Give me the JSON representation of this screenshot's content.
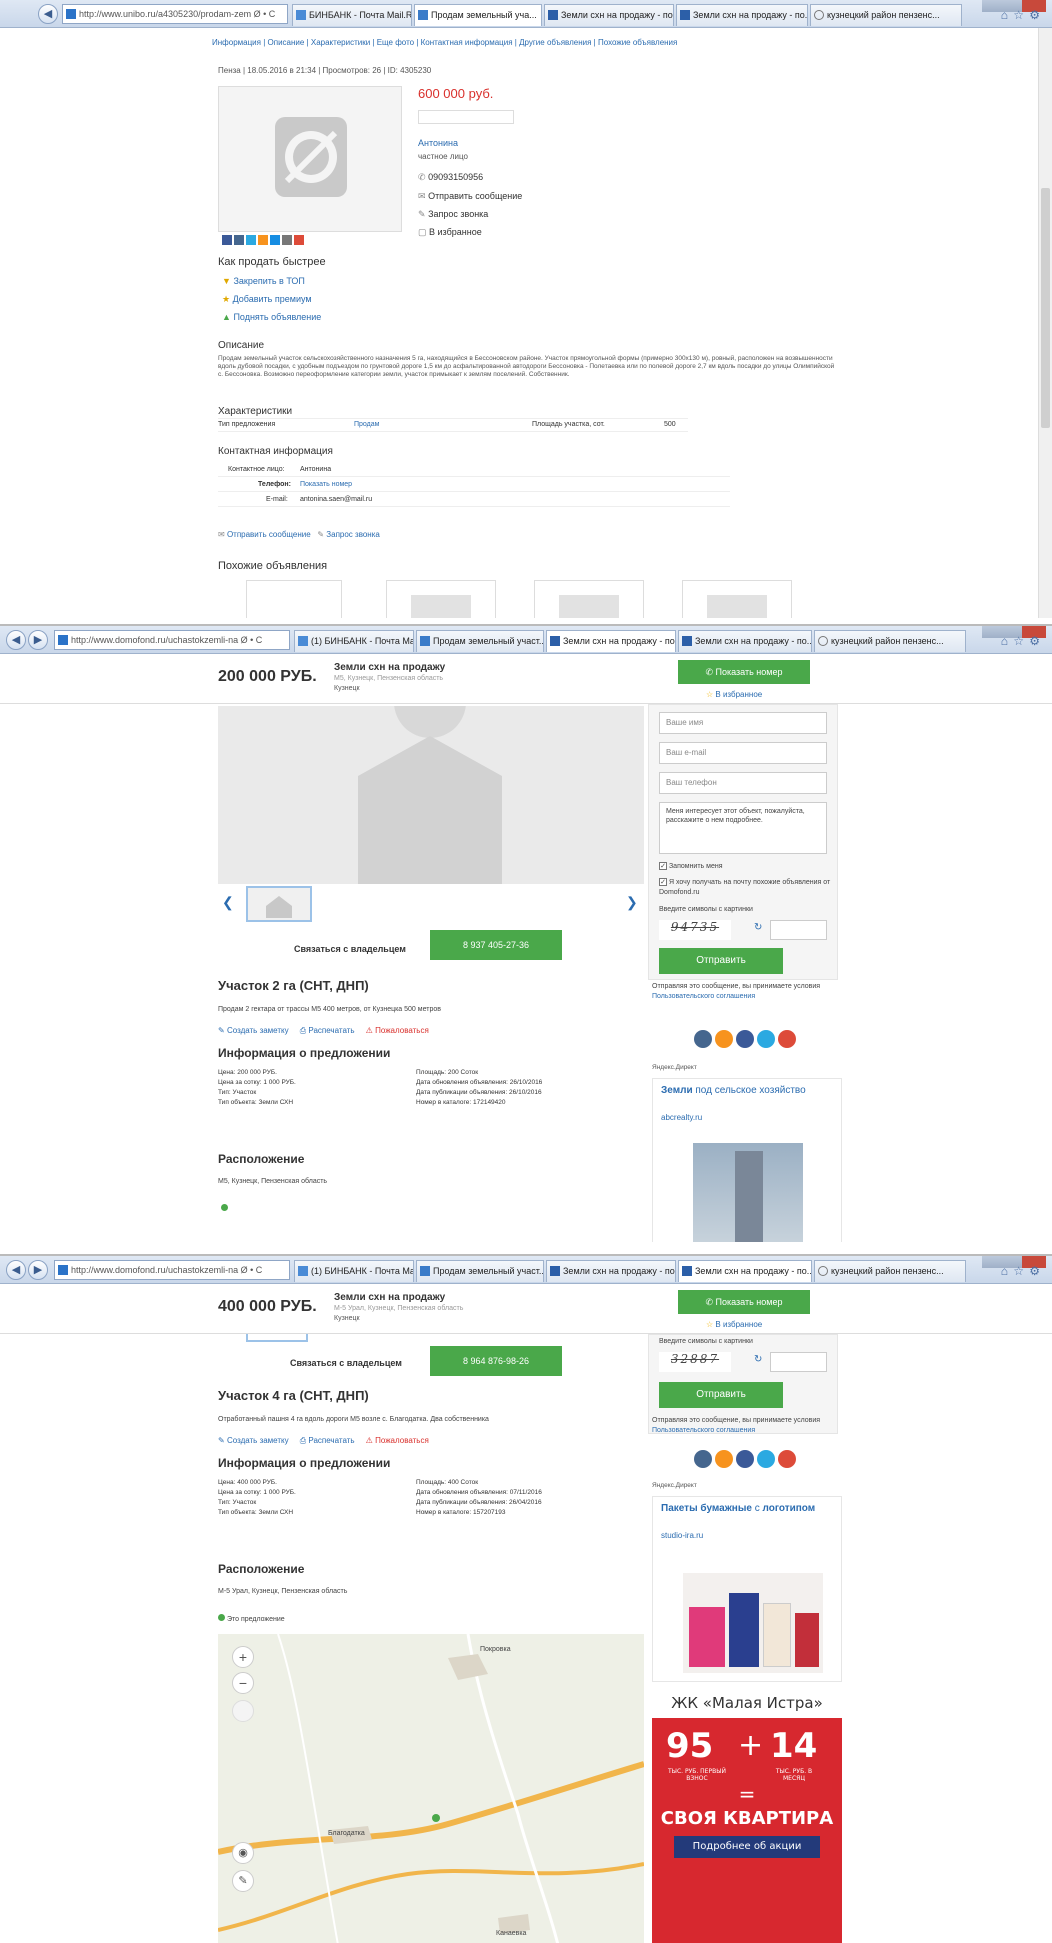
{
  "browser": {
    "p1": {
      "url": "http://www.unibo.ru/a4305230/prodam-zem Ø • C",
      "tabs": [
        "БИНБАНК - Почта Mail.Ru",
        "Продам земельный уча...",
        "Земли схн на продажу - по...",
        "Земли схн на продажу - по...",
        "кузнецкий район пензенс..."
      ]
    },
    "p2": {
      "url": "http://www.domofond.ru/uchastokzemli-na Ø • C",
      "tabs": [
        "(1) БИНБАНК - Почта Mail...",
        "Продам земельный участ...",
        "Земли схн на продажу - по...",
        "Земли схн на продажу - по...",
        "кузнецкий район пензенс..."
      ]
    },
    "p3": {
      "url": "http://www.domofond.ru/uchastokzemli-na Ø • C",
      "tabs": [
        "(1) БИНБАНК - Почта Mail...",
        "Продам земельный участ...",
        "Земли схн на продажу - по...",
        "Земли схн на продажу - по...",
        "кузнецкий район пензенс..."
      ]
    }
  },
  "listing1": {
    "subnav": [
      "Информация",
      "Описание",
      "Характеристики",
      "Еще фото",
      "Контактная информация",
      "Другие объявления",
      "Похожие объявления"
    ],
    "meta": "Пенза | 18.05.2016 в 21:34 | Просмотров: 26 | ID: 4305230",
    "price": "600 000 руб.",
    "seller_name": "Антонина",
    "seller_type": "частное лицо",
    "phone": "09093150956",
    "actions": [
      "Отправить сообщение",
      "Запрос звонка",
      "В избранное"
    ],
    "sell_faster_title": "Как продать быстрее",
    "sell_faster": [
      "Закрепить в ТОП",
      "Добавить премиум",
      "Поднять объявление"
    ],
    "desc_title": "Описание",
    "desc": "Продам земельный участок сельскохозяйственного назначения 5 га, находящийся в Бессоновском районе. Участок прямоугольной формы (примерно 300х130 м), ровный, расположен на возвышенности вдоль дубовой посадки, с удобным подъездом по грунтовой дороге 1,5 км до асфальтированной автодороги Бессоновка - Полетаевка или по полевой дороге 2,7 км вдоль посадки до улицы Олимпийской с. Бессоновка. Возможно переоформление категории земли, участок примыкает к землям поселений. Собственник.",
    "chars_title": "Характеристики",
    "chars": {
      "type_label": "Тип предложения",
      "type_value": "Продам",
      "area_label": "Площадь участка, сот.",
      "area_value": "500"
    },
    "contact_title": "Контактная информация",
    "contact": {
      "person_label": "Контактное лицо:",
      "person": "Антонина",
      "phone_label": "Телефон:",
      "phone_link": "Показать номер",
      "email_label": "E-mail:",
      "email": "antonina.saen@mail.ru"
    },
    "bottom_actions": [
      "Отправить сообщение",
      "Запрос звонка"
    ],
    "similar_title": "Похожие объявления"
  },
  "listing2": {
    "price": "200 000 РУБ.",
    "heading": "Земли схн на продажу",
    "address": "М5, Кузнецк, Пензенская область",
    "city": "Кузнецк",
    "show_number": "Показать номер",
    "favorites": "В избранное",
    "form": {
      "name": "Ваше имя",
      "email": "Ваш e-mail",
      "phone": "Ваш телефон",
      "message": "Меня интересует этот объект, пожалуйста, расскажите о нем подробнее.",
      "remember": "Запомнить меня",
      "subscribe": "Я хочу получать на почту похожие объявления от Domofond.ru",
      "captcha_label": "Введите символы с картинки",
      "captcha_text": "94735",
      "submit": "Отправить",
      "terms": "Отправляя это сообщение, вы принимаете условия",
      "terms_link": "Пользовательского соглашения"
    },
    "contact_owner": "Связаться с владельцем",
    "phone": "8 937 405-27-36",
    "title": "Участок 2 га (СНТ, ДНП)",
    "desc": "Продам 2 гектара от трассы М5 400 метров, от Кузнецка 500 метров",
    "links": [
      "Создать заметку",
      "Распечатать",
      "Пожаловаться"
    ],
    "info_title": "Информация о предложении",
    "info_left": [
      "Цена: 200 000 РУБ.",
      "Цена за сотку: 1 000 РУБ.",
      "Тип: Участок",
      "Тип объекта: Земли СХН"
    ],
    "info_right": [
      "Площадь: 200 Соток",
      "Дата обновления объявления: 26/10/2016",
      "Дата публикации объявления: 26/10/2016",
      "Номер в каталоге: 172149420"
    ],
    "location_title": "Расположение",
    "location": "М5, Кузнецк, Пензенская область",
    "ad_label": "Яндекс.Директ",
    "ad_title": "Земли",
    "ad_title_rest": " под сельское хозяйство",
    "ad_domain": "abcrealty.ru"
  },
  "listing3": {
    "price": "400 000 РУБ.",
    "heading": "Земли схн на продажу",
    "address": "М-5 Урал, Кузнецк, Пензенская область",
    "city": "Кузнецк",
    "show_number": "Показать номер",
    "favorites": "В избранное",
    "captcha_label": "Введите символы с картинки",
    "captcha_text": "32887",
    "submit": "Отправить",
    "terms": "Отправляя это сообщение, вы принимаете условия",
    "terms_link": "Пользовательского соглашения",
    "contact_owner": "Связаться с владельцем",
    "phone": "8 964 876-98-26",
    "title": "Участок 4 га (СНТ, ДНП)",
    "desc": "Отработанный пашня 4 га вдоль дороги М5 возле с. Благодатка. Два собственника",
    "links": [
      "Создать заметку",
      "Распечатать",
      "Пожаловаться"
    ],
    "info_title": "Информация о предложении",
    "info_left": [
      "Цена: 400 000 РУБ.",
      "Цена за сотку: 1 000 РУБ.",
      "Тип: Участок",
      "Тип объекта: Земли СХН"
    ],
    "info_right": [
      "Площадь: 400 Соток",
      "Дата обновления объявления: 07/11/2016",
      "Дата публикации объявления: 26/04/2016",
      "Номер в каталоге: 157207193"
    ],
    "location_title": "Расположение",
    "location": "М-5 Урал, Кузнецк, Пензенская область",
    "this_offer": "Это предложение",
    "map_labels": [
      "Покровка",
      "Благодатка",
      "Канаевка"
    ],
    "ad_label": "Яндекс.Директ",
    "ad_title": "Пакеты бумажные",
    "ad_title_mid": " с ",
    "ad_title_end": "логотипом",
    "ad_domain": "studio-ira.ru",
    "banner": {
      "title": "ЖК «Малая Истра»",
      "n1": "95",
      "plus": "+",
      "n2": "14",
      "sub1": "ТЫС. РУБ. ПЕРВЫЙ ВЗНОС",
      "sub2": "ТЫС. РУБ. В МЕСЯЦ",
      "eq": "=",
      "result": "СВОЯ КВАРТИРА",
      "cta": "Подробнее об акции"
    }
  },
  "colors": {
    "accent_green": "#4aa84a",
    "price_red": "#d9302c",
    "link_blue": "#2b6cb0",
    "banner_red": "#d7282f"
  }
}
